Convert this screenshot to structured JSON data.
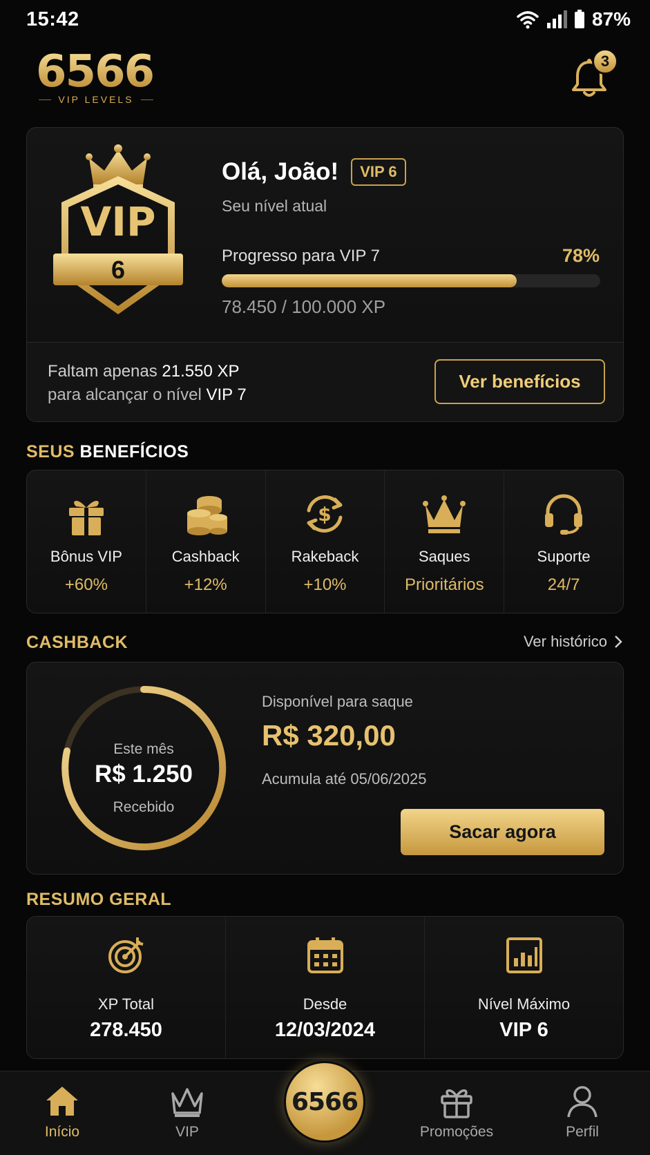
{
  "status_bar": {
    "time": "15:42",
    "battery": "87%"
  },
  "header": {
    "logo_number": "6566",
    "logo_sub": "VIP LEVELS",
    "notifications": "3"
  },
  "vip_card": {
    "greeting": "Olá, João!",
    "badge": "VIP 6",
    "emblem_text": "VIP",
    "emblem_level": "6",
    "level_label": "Seu nível atual",
    "progress_label": "Progresso para VIP 7",
    "progress_percent": "78%",
    "progress_fraction": 0.78,
    "xp_text": "78.450 / 100.000 XP",
    "remaining_prefix": "Faltam apenas ",
    "remaining_xp": "21.550 XP",
    "reach_prefix": "para alcançar o nível ",
    "next_level": "VIP 7",
    "benefits_button": "Ver benefícios"
  },
  "benefits": {
    "title_gold": "SEUS",
    "title_white": " BENEFÍCIOS",
    "items": [
      {
        "name": "Bônus VIP",
        "value": "+60%",
        "icon": "gift-icon"
      },
      {
        "name": "Cashback",
        "value": "+12%",
        "icon": "coins-icon"
      },
      {
        "name": "Rakeback",
        "value": "+10%",
        "icon": "dollar-cycle-icon"
      },
      {
        "name": "Saques",
        "value": "Prioritários",
        "icon": "crown-icon"
      },
      {
        "name": "Suporte",
        "value": "24/7",
        "icon": "headset-icon"
      }
    ]
  },
  "cashback": {
    "title": "CASHBACK",
    "history_link": "Ver histórico",
    "ring_label_top": "Este mês",
    "ring_amount": "R$ 1.250",
    "ring_label_bottom": "Recebido",
    "available_label": "Disponível para saque",
    "available_amount": "R$ 320,00",
    "accumulates": "Acumula até 05/06/2025",
    "withdraw_button": "Sacar agora"
  },
  "summary": {
    "title": "RESUMO GERAL",
    "items": [
      {
        "label": "XP Total",
        "value": "278.450",
        "icon": "target-icon"
      },
      {
        "label": "Desde",
        "value": "12/03/2024",
        "icon": "calendar-icon"
      },
      {
        "label": "Nível Máximo",
        "value": "VIP 6",
        "icon": "chart-icon"
      }
    ]
  },
  "bottom_nav": {
    "items": [
      {
        "label": "Início",
        "icon": "home-icon"
      },
      {
        "label": "VIP",
        "icon": "crown-icon"
      },
      {
        "label": "Promoções",
        "icon": "gift-icon"
      },
      {
        "label": "Perfil",
        "icon": "user-icon"
      }
    ],
    "center_label": "6566"
  },
  "colors": {
    "accent_gold": "#e0bc67",
    "background": "#070707",
    "card": "#131313"
  }
}
